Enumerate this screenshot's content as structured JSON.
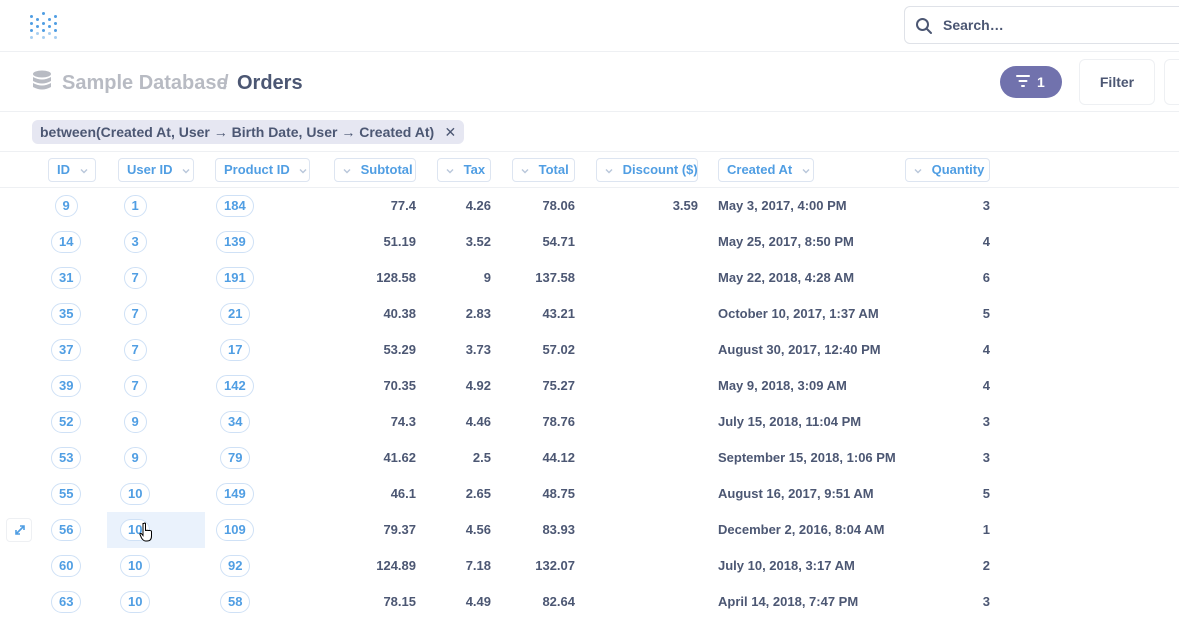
{
  "nav": {
    "logo": "metabase-logo",
    "search_placeholder": "Search…",
    "search_icon": "search-icon"
  },
  "header": {
    "database": "Sample Database",
    "separator": "/",
    "table": "Orders",
    "filter_count": "1",
    "filter_label": "Filter",
    "db_icon": "database-icon"
  },
  "filter_pill": {
    "label": "between(Created At, User → Birth Date, User → Created At)",
    "close": "✕"
  },
  "table": {
    "columns": [
      "ID",
      "User ID",
      "Product ID",
      "Subtotal",
      "Tax",
      "Total",
      "Discount ($)",
      "Created At",
      "Quantity"
    ],
    "rows": [
      [
        "9",
        "1",
        "184",
        "77.4",
        "4.26",
        "78.06",
        "3.59",
        "May 3, 2017, 4:00 PM",
        "3"
      ],
      [
        "14",
        "3",
        "139",
        "51.19",
        "3.52",
        "54.71",
        "",
        "May 25, 2017, 8:50 PM",
        "4"
      ],
      [
        "31",
        "7",
        "191",
        "128.58",
        "9",
        "137.58",
        "",
        "May 22, 2018, 4:28 AM",
        "6"
      ],
      [
        "35",
        "7",
        "21",
        "40.38",
        "2.83",
        "43.21",
        "",
        "October 10, 2017, 1:37 AM",
        "5"
      ],
      [
        "37",
        "7",
        "17",
        "53.29",
        "3.73",
        "57.02",
        "",
        "August 30, 2017, 12:40 PM",
        "4"
      ],
      [
        "39",
        "7",
        "142",
        "70.35",
        "4.92",
        "75.27",
        "",
        "May 9, 2018, 3:09 AM",
        "4"
      ],
      [
        "52",
        "9",
        "34",
        "74.3",
        "4.46",
        "78.76",
        "",
        "July 15, 2018, 11:04 PM",
        "3"
      ],
      [
        "53",
        "9",
        "79",
        "41.62",
        "2.5",
        "44.12",
        "",
        "September 15, 2018, 1:06 PM",
        "3"
      ],
      [
        "55",
        "10",
        "149",
        "46.1",
        "2.65",
        "48.75",
        "",
        "August 16, 2017, 9:51 AM",
        "5"
      ],
      [
        "56",
        "10",
        "109",
        "79.37",
        "4.56",
        "83.93",
        "",
        "December 2, 2016, 8:04 AM",
        "1"
      ],
      [
        "60",
        "10",
        "92",
        "124.89",
        "7.18",
        "132.07",
        "",
        "July 10, 2018, 3:17 AM",
        "2"
      ],
      [
        "63",
        "10",
        "58",
        "78.15",
        "4.49",
        "82.64",
        "",
        "April 14, 2018, 7:47 PM",
        "3"
      ]
    ]
  },
  "colors": {
    "brand": "#509ee3",
    "filter_accent": "#7172ad",
    "text": "#4c5773"
  }
}
